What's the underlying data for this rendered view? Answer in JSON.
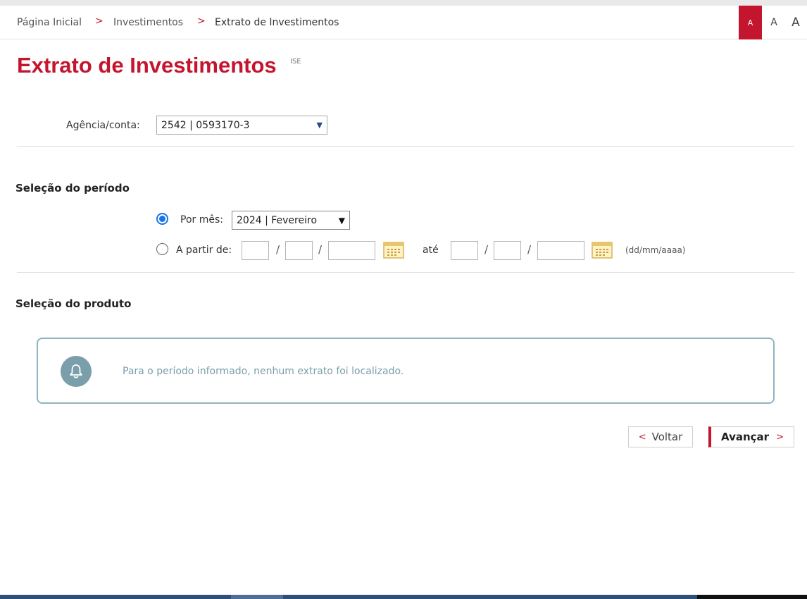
{
  "breadcrumb": {
    "items": [
      "Página Inicial",
      "Investimentos",
      "Extrato de Investimentos"
    ],
    "separator": ">"
  },
  "font_size_controls": {
    "small": "A",
    "medium": "A",
    "large": "A"
  },
  "page": {
    "title": "Extrato de Investimentos",
    "badge": "ISE"
  },
  "account": {
    "label": "Agência/conta:",
    "selected": "2542 | 0593170-3"
  },
  "period": {
    "section_title": "Seleção do período",
    "by_month": {
      "label": "Por mês:",
      "selected": "2024 | Fevereiro",
      "checked": true
    },
    "from_date": {
      "label": "A partir de:",
      "checked": false,
      "separator": "/",
      "until_label": "até",
      "format_hint": "(dd/mm/aaaa)",
      "start": {
        "day": "",
        "month": "",
        "year": ""
      },
      "end": {
        "day": "",
        "month": "",
        "year": ""
      }
    }
  },
  "product": {
    "section_title": "Seleção do produto",
    "message": "Para o período informado, nenhum extrato foi localizado."
  },
  "actions": {
    "back_label": "Voltar",
    "next_label": "Avançar"
  },
  "colors": {
    "brand_red": "#c4152e",
    "info_teal": "#7a9eaa",
    "info_border": "#8fb4c0",
    "radio_blue": "#1a73e8"
  },
  "icons": {
    "calendar": "calendar-icon",
    "bell": "bell-icon"
  }
}
